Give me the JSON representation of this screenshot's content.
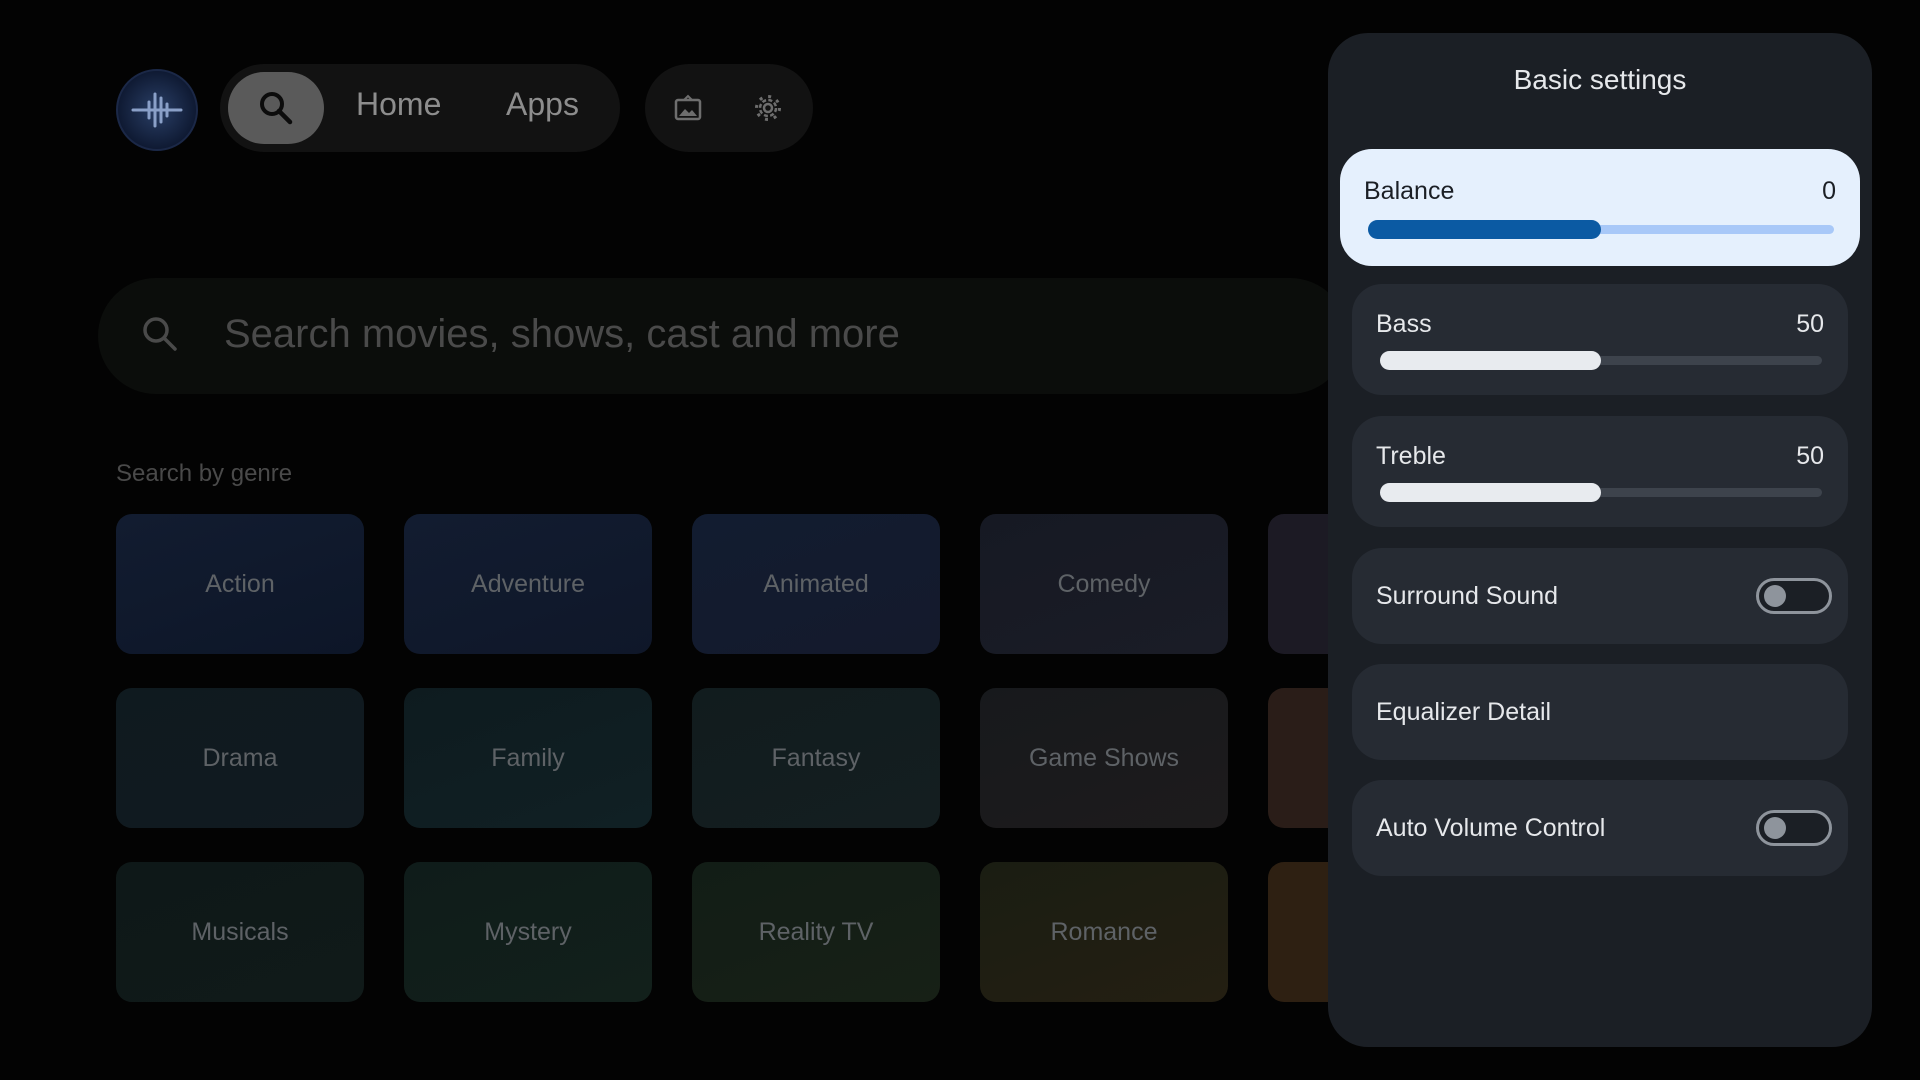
{
  "top_nav": {
    "home_label": "Home",
    "apps_label": "Apps"
  },
  "search": {
    "placeholder": "Search movies, shows, cast and more"
  },
  "genres": {
    "heading": "Search by genre",
    "items": [
      "Action",
      "Adventure",
      "Animated",
      "Comedy",
      "Drama",
      "Family",
      "Fantasy",
      "Game Shows",
      "Musicals",
      "Mystery",
      "Reality TV",
      "Romance"
    ]
  },
  "settings_panel": {
    "title": "Basic settings",
    "balance": {
      "label": "Balance",
      "value": "0",
      "level": 0.5
    },
    "bass": {
      "label": "Bass",
      "value": "50",
      "level": 0.5
    },
    "treble": {
      "label": "Treble",
      "value": "50",
      "level": 0.5
    },
    "surround_sound": {
      "label": "Surround Sound",
      "enabled": false
    },
    "equalizer_detail": {
      "label": "Equalizer Detail"
    },
    "auto_volume_control": {
      "label": "Auto Volume Control",
      "enabled": false
    }
  },
  "colors": {
    "panel_bg": "#1b1f25",
    "row_bg": "#262b33",
    "focused_row_bg": "#e5f0fd",
    "focused_fill": "#0b5aa3",
    "slider_fill": "#e8ebef"
  }
}
